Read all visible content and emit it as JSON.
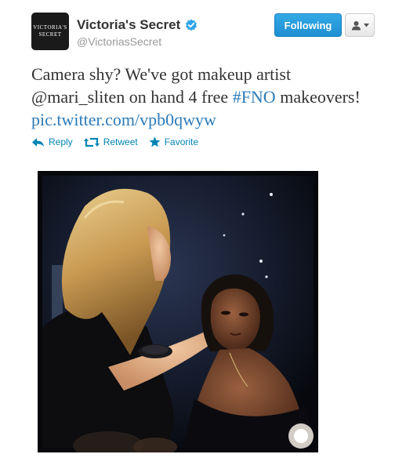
{
  "user": {
    "name": "Victoria's Secret",
    "handle": "@VictoriasSecret",
    "avatar_logo": [
      "VICTORIA'S",
      "SECRET"
    ]
  },
  "buttons": {
    "follow_label": "Following"
  },
  "tweet": {
    "text_1": "Camera shy? We've got makeup artist @mari_sliten on hand 4 free ",
    "hashtag": "#FNO",
    "text_2": " makeovers! ",
    "link": "pic.twitter.com/vpb0qwyw"
  },
  "actions": {
    "reply": "Reply",
    "retweet": "Retweet",
    "favorite": "Favorite"
  },
  "colors": {
    "accent": "#0084b4",
    "follow_button": "#2ba0e3",
    "link": "#2b7bb9"
  },
  "icons": [
    "verified-badge-icon",
    "user-icon",
    "chevron-down-icon",
    "reply-icon",
    "retweet-icon",
    "star-icon"
  ]
}
